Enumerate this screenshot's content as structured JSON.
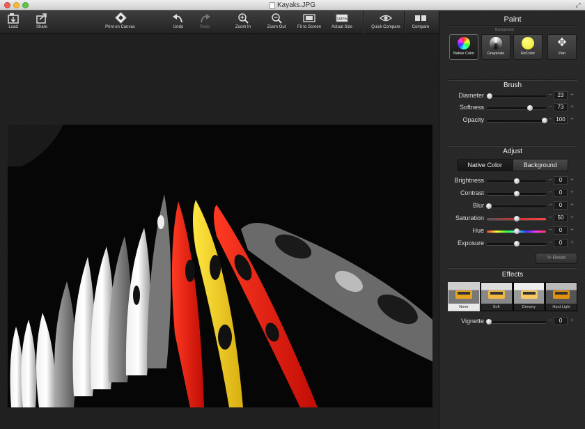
{
  "window": {
    "title": "Kayaks.JPG"
  },
  "toolbar": {
    "load": "Load",
    "share": "Share",
    "print": "Print on Canvas",
    "undo": "Undo",
    "redo": "Redo",
    "zoom_in": "Zoom In",
    "zoom_out": "Zoom Out",
    "fit": "Fit to Screen",
    "actual": "Actual Size",
    "actual_badge": "100%",
    "quick_compare": "Quick Compare",
    "compare": "Compare"
  },
  "paint": {
    "title": "Paint",
    "background_caption": "Background",
    "modes": [
      "Native Color",
      "Grayscale",
      "ReColor",
      "Pan"
    ]
  },
  "brush": {
    "title": "Brush",
    "sliders": [
      {
        "label": "Diameter",
        "value": "23",
        "pos": 0.05
      },
      {
        "label": "Softness",
        "value": "73",
        "pos": 0.73
      },
      {
        "label": "Opacity",
        "value": "100",
        "pos": 1.0
      }
    ]
  },
  "adjust": {
    "title": "Adjust",
    "tabs": [
      "Native Color",
      "Background"
    ],
    "sliders": [
      {
        "label": "Brightness",
        "value": "0",
        "pos": 0.5
      },
      {
        "label": "Contrast",
        "value": "0",
        "pos": 0.5
      },
      {
        "label": "Blur",
        "value": "0",
        "pos": 0.0
      },
      {
        "label": "Saturation",
        "value": "50",
        "pos": 0.5
      },
      {
        "label": "Hue",
        "value": "0",
        "pos": 0.5
      },
      {
        "label": "Exposure",
        "value": "0",
        "pos": 0.5
      }
    ],
    "reset": "Reset"
  },
  "effects": {
    "title": "Effects",
    "items": [
      "None",
      "Soft",
      "Dreamy",
      "Hard Light"
    ],
    "vignette": {
      "label": "Vignette",
      "value": "0",
      "pos": 0.0
    }
  },
  "colors": {
    "accent_red": "#e11a10",
    "accent_yellow": "#f2d21a",
    "panel_bg": "#2a2a2a"
  }
}
